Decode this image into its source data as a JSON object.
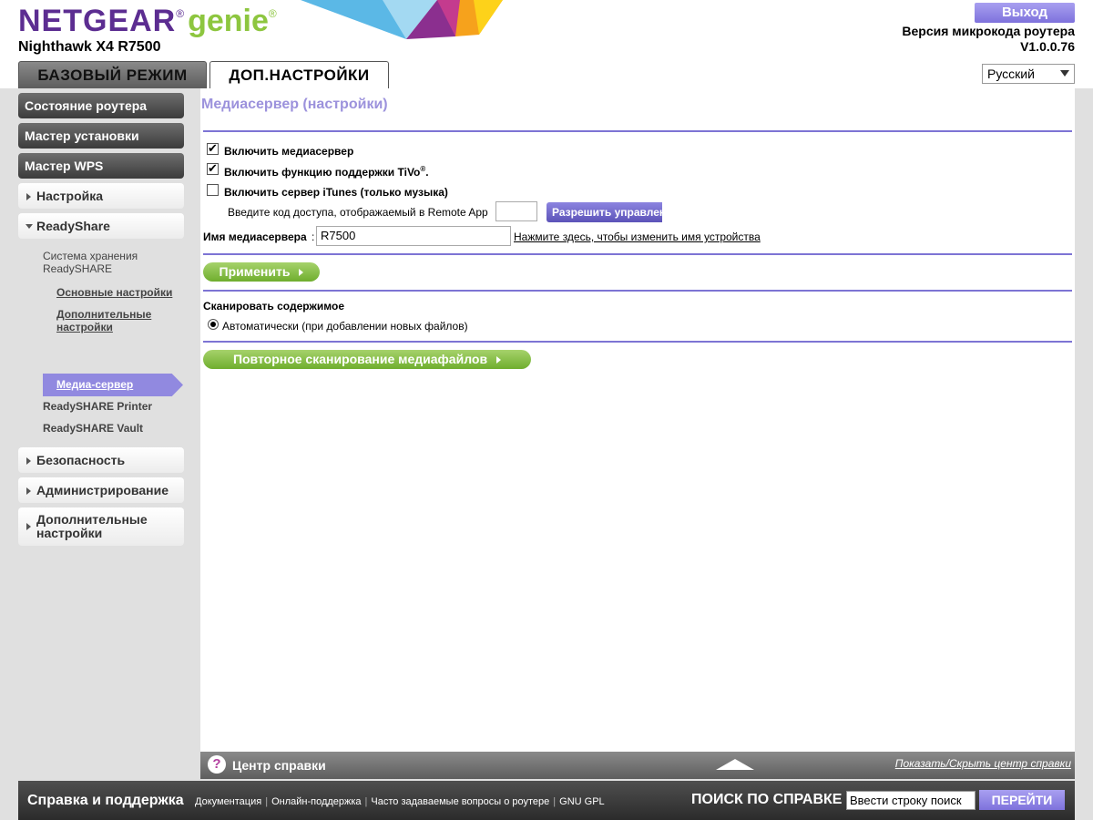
{
  "header": {
    "logo_brand": "NETGEAR",
    "logo_product": "genie",
    "logo_reg": "®",
    "model": "Nighthawk X4 R7500",
    "logout_label": "Выход",
    "firmware_label": "Версия микрокода роутера",
    "firmware_version": "V1.0.0.76",
    "tabs": [
      {
        "label": "БАЗОВЫЙ РЕЖИМ",
        "active": false
      },
      {
        "label": "ДОП.НАСТРОЙКИ",
        "active": true
      }
    ],
    "language": "Русский"
  },
  "sidebar": {
    "dark_items": [
      {
        "label": "Состояние роутера"
      },
      {
        "label": "Мастер установки"
      },
      {
        "label": "Мастер WPS"
      }
    ],
    "setup_label": "Настройка",
    "readyshare_label": "ReadyShare",
    "readyshare_storage": "Система хранения ReadySHARE",
    "readyshare_storage_line1": "Система хранения",
    "readyshare_storage_line2": "ReadySHARE",
    "basic_settings": "Основные настройки",
    "advanced_settings_line1": "Дополнительные",
    "advanced_settings_line2": "настройки",
    "media_server": "Медиа-сервер",
    "printer": "ReadySHARE Printer",
    "vault": "ReadySHARE Vault",
    "security": "Безопасность",
    "administration": "Администрирование",
    "advanced_line1": "Дополнительные",
    "advanced_line2": "настройки"
  },
  "content": {
    "title": "Медиасервер (настройки)",
    "enable_media_server": {
      "label": "Включить медиасервер",
      "checked": true
    },
    "enable_tivo": {
      "label": "Включить функцию поддержки TiVo",
      "sup": "®",
      "suffix": ".",
      "checked": true
    },
    "enable_itunes": {
      "label": "Включить сервер iTunes (только музыка)",
      "checked": false
    },
    "access_code_label": "Введите код доступа, отображаемый в Remote App",
    "access_code_value": "",
    "allow_control_label": "Разрешить управление",
    "media_server_name_label": "Имя медиасервера",
    "colon": ":",
    "media_server_name_value": "R7500",
    "change_name_link": "Нажмите здесь, чтобы изменить имя устройства",
    "apply_label": "Применить",
    "scan_label": "Сканировать содержимое",
    "scan_auto_label": "Автоматически (при добавлении новых файлов)",
    "scan_auto_selected": true,
    "rescan_label": "Повторное сканирование медиафайлов"
  },
  "helpbar": {
    "icon": "?",
    "title": "Центр справки",
    "toggle_label": "Показать/Скрыть центр справки"
  },
  "footer": {
    "title": "Справка и поддержка",
    "links": [
      "Документация",
      "Онлайн-поддержка",
      "Часто задаваемые вопросы о роутере",
      "GNU GPL"
    ],
    "search_label": "ПОИСК ПО СПРАВКЕ",
    "search_placeholder": "Ввести строку поиск",
    "go_label": "ПЕРЕЙТИ"
  },
  "colors": {
    "brand_purple": "#5c2d91",
    "brand_green": "#8dc63f",
    "accent_lavender": "#9189e0",
    "button_green": "#6fae2e"
  }
}
